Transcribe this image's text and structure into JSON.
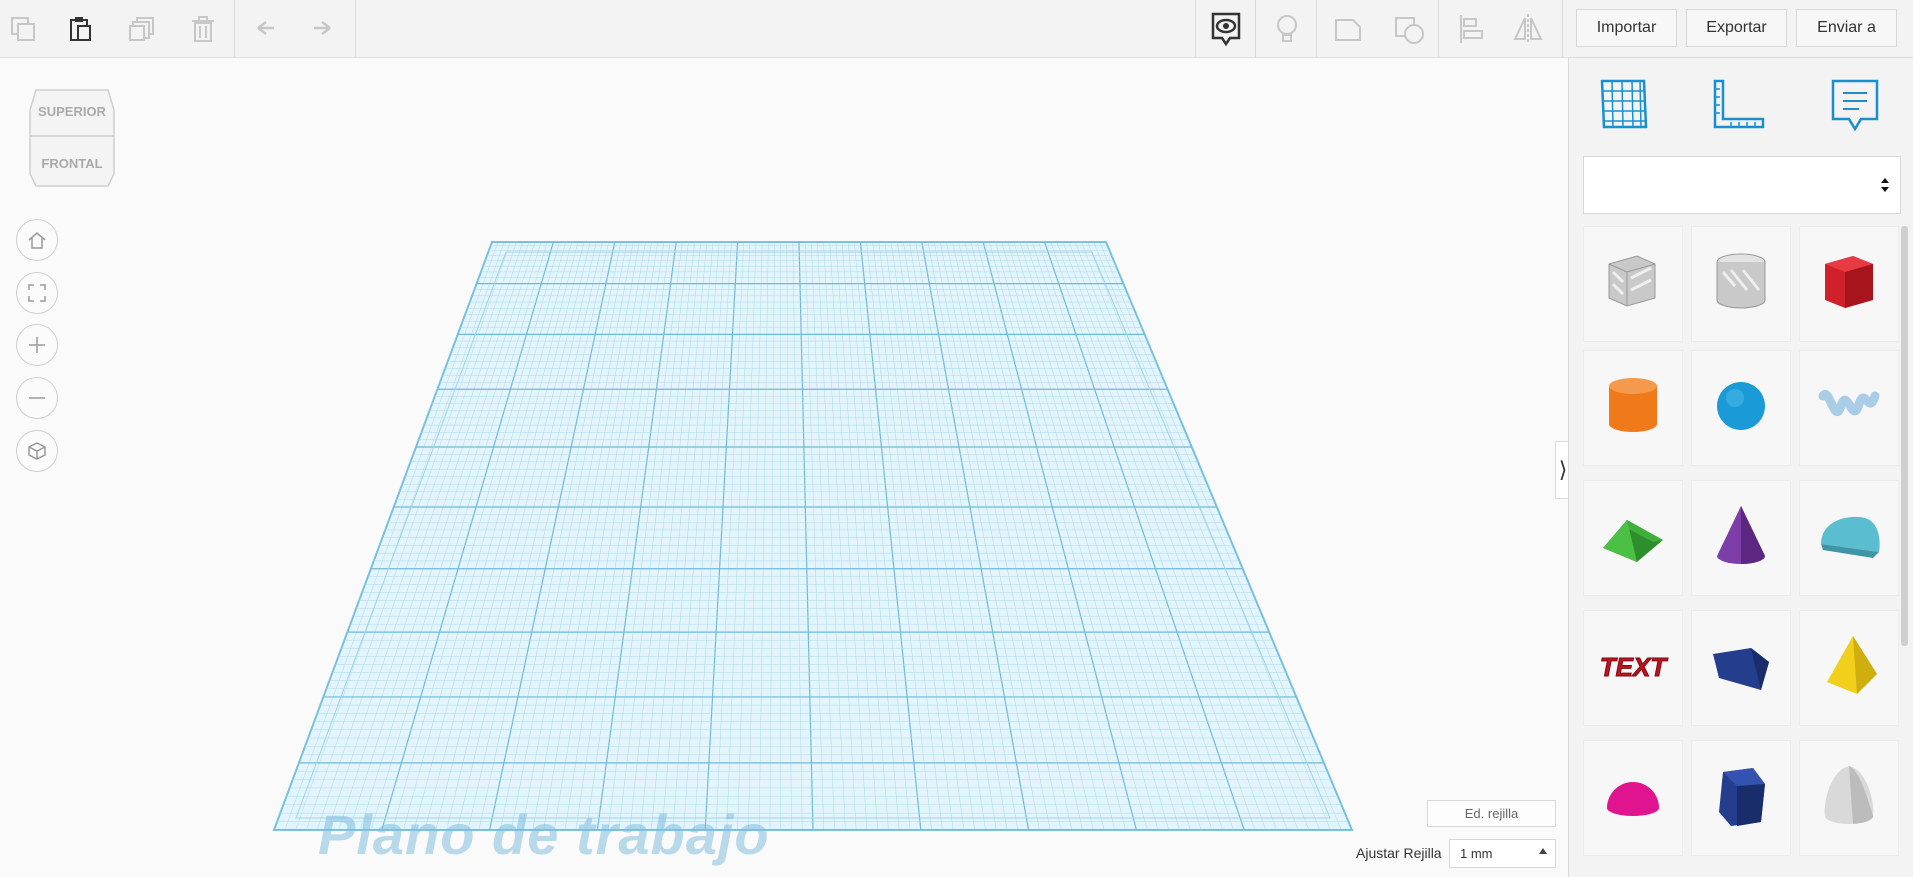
{
  "toolbar": {
    "import_label": "Importar",
    "export_label": "Exportar",
    "send_label": "Enviar a"
  },
  "viewcube": {
    "top_label": "SUPERIOR",
    "front_label": "FRONTAL"
  },
  "workplane": {
    "label": "Plano de trabajo",
    "edit_grid_label": "Ed. rejilla",
    "snap_label": "Ajustar Rejilla",
    "snap_value": "1 mm"
  },
  "panel": {
    "shapes": [
      {
        "name": "box-hole",
        "color": "#c9c9c9"
      },
      {
        "name": "cylinder-hole",
        "color": "#c9c9c9"
      },
      {
        "name": "box",
        "color": "#d0202a"
      },
      {
        "name": "cylinder",
        "color": "#f07a1a"
      },
      {
        "name": "sphere",
        "color": "#1a9bd7"
      },
      {
        "name": "scribble",
        "color": "#a9cde6"
      },
      {
        "name": "roof",
        "color": "#3fae3a"
      },
      {
        "name": "cone",
        "color": "#7e3ea8"
      },
      {
        "name": "round-roof",
        "color": "#5bbed0"
      },
      {
        "name": "text",
        "color": "#c3121e"
      },
      {
        "name": "wedge",
        "color": "#243e8d"
      },
      {
        "name": "pyramid",
        "color": "#f1cf1b"
      },
      {
        "name": "half-sphere",
        "color": "#e0148f"
      },
      {
        "name": "polygon",
        "color": "#243e8d"
      },
      {
        "name": "paraboloid",
        "color": "#d9d9d9"
      }
    ]
  },
  "colors": {
    "accent": "#1a8fd0",
    "grid": "#8ccde6"
  }
}
